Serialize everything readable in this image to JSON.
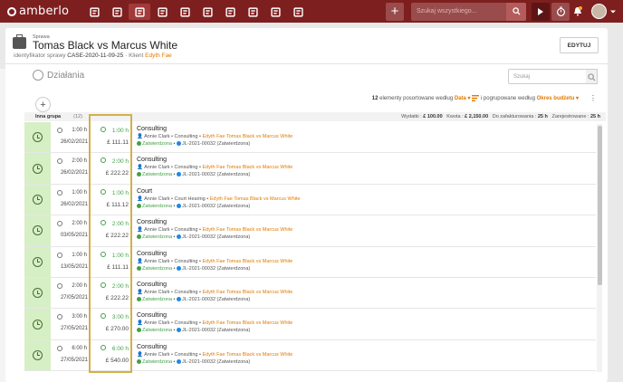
{
  "app": {
    "name": "amberlo"
  },
  "topbar": {
    "nav_icons": [
      "dashboard-icon",
      "contact-card-icon",
      "briefcase-icon",
      "document-icon",
      "bank-icon",
      "calendar-icon",
      "timer-icon",
      "folder-icon",
      "inbox-icon",
      "reports-icon"
    ],
    "active_index": 2,
    "add_label": "+",
    "search_placeholder": "Szukaj wszystkiego..."
  },
  "sidebar": {
    "items": [
      "document-icon",
      "users-cog-icon",
      "share-icon",
      "billing-alert-icon",
      "calendar-alert-icon",
      "timer-icon",
      "transfer-icon",
      "money-doc-icon",
      "money-doc2-icon",
      "mail-money-icon",
      "box-icon"
    ]
  },
  "header": {
    "crumb": "Sprawa",
    "title": "Tomas Black vs Marcus White",
    "id_label": "identyfikator sprawy",
    "case_id": "CASE-2020-11-09-25",
    "client_label": "Klient",
    "client_name": "Edyth Fae",
    "edit_label": "EDYTUJ"
  },
  "section": {
    "title": "Działania",
    "search_placeholder": "Szukaj"
  },
  "sort": {
    "count_text": "12",
    "count_rest": "elementy posortowane według",
    "sort_by": "Data",
    "group_text": "i pogrupowane według",
    "group_by": "Okres budżetu"
  },
  "group": {
    "name": "Inna grupa",
    "count": "(12)",
    "expenses_label": "Wydatki :",
    "expenses": "£ 100.00",
    "amount_label": "Kwota :",
    "amount": "£ 2,150.00",
    "to_invoice_label": "Do zafakturowania :",
    "to_invoice": "25 h",
    "recorded_label": "Zarejestrowane :",
    "recorded": "25 h"
  },
  "rows": [
    {
      "hours": "1:00 h",
      "date": "26/02/2021",
      "billable": "1:00 h",
      "amount": "£ 111.11",
      "title": "Consulting",
      "user": "Annie Clark",
      "type": "Consulting",
      "client": "Edyth Fae",
      "matter": "Tomas Black vs Marcus White",
      "status": "Zatwierdzona",
      "invoice": "JL-2021-00032 (Zatwierdzona)"
    },
    {
      "hours": "2:00 h",
      "date": "26/02/2021",
      "billable": "2:00 h",
      "amount": "£ 222.22",
      "title": "Consulting",
      "user": "Annie Clark",
      "type": "Consulting",
      "client": "Edyth Fae",
      "matter": "Tomas Black vs Marcus White",
      "status": "Zatwierdzona",
      "invoice": "JL-2021-00032 (Zatwierdzona)"
    },
    {
      "hours": "1:00 h",
      "date": "26/02/2021",
      "billable": "1:00 h",
      "amount": "£ 111.12",
      "title": "Court",
      "user": "Annie Clark",
      "type": "Court Hearing",
      "client": "Edyth Fae",
      "matter": "Tomas Black vs Marcus White",
      "status": "Zatwierdzona",
      "invoice": "JL-2021-00032 (Zatwierdzona)"
    },
    {
      "hours": "2:00 h",
      "date": "03/05/2021",
      "billable": "2:00 h",
      "amount": "£ 222.22",
      "title": "Consulting",
      "user": "Annie Clark",
      "type": "Consulting",
      "client": "Edyth Fae",
      "matter": "Tomas Black vs Marcus White",
      "status": "Zatwierdzona",
      "invoice": "JL-2021-00032 (Zatwierdzona)"
    },
    {
      "hours": "1:00 h",
      "date": "13/05/2021",
      "billable": "1:00 h",
      "amount": "£ 111.11",
      "title": "Consulting",
      "user": "Annie Clark",
      "type": "Consulting",
      "client": "Edyth Fae",
      "matter": "Tomas Black vs Marcus White",
      "status": "Zatwierdzona",
      "invoice": "JL-2021-00032 (Zatwierdzona)"
    },
    {
      "hours": "2:00 h",
      "date": "27/05/2021",
      "billable": "2:00 h",
      "amount": "£ 222.22",
      "title": "Consulting",
      "user": "Annie Clark",
      "type": "Consulting",
      "client": "Edyth Fae",
      "matter": "Tomas Black vs Marcus White",
      "status": "Zatwierdzona",
      "invoice": "JL-2021-00032 (Zatwierdzona)"
    },
    {
      "hours": "3:00 h",
      "date": "27/05/2021",
      "billable": "3:00 h",
      "amount": "£ 270.00",
      "title": "Consulting",
      "user": "Annie Clark",
      "type": "Consulting",
      "client": "Edyth Fae",
      "matter": "Tomas Black vs Marcus White",
      "status": "Zatwierdzona",
      "invoice": "JL-2021-00032 (Zatwierdzona)"
    },
    {
      "hours": "6:00 h",
      "date": "27/05/2021",
      "billable": "6:00 h",
      "amount": "£ 540.00",
      "title": "Consulting",
      "user": "Annie Clark",
      "type": "Consulting",
      "client": "Edyth Fae",
      "matter": "Tomas Black vs Marcus White",
      "status": "Zatwierdzona",
      "invoice": "JL-2021-00032 (Zatwierdzona)"
    }
  ]
}
